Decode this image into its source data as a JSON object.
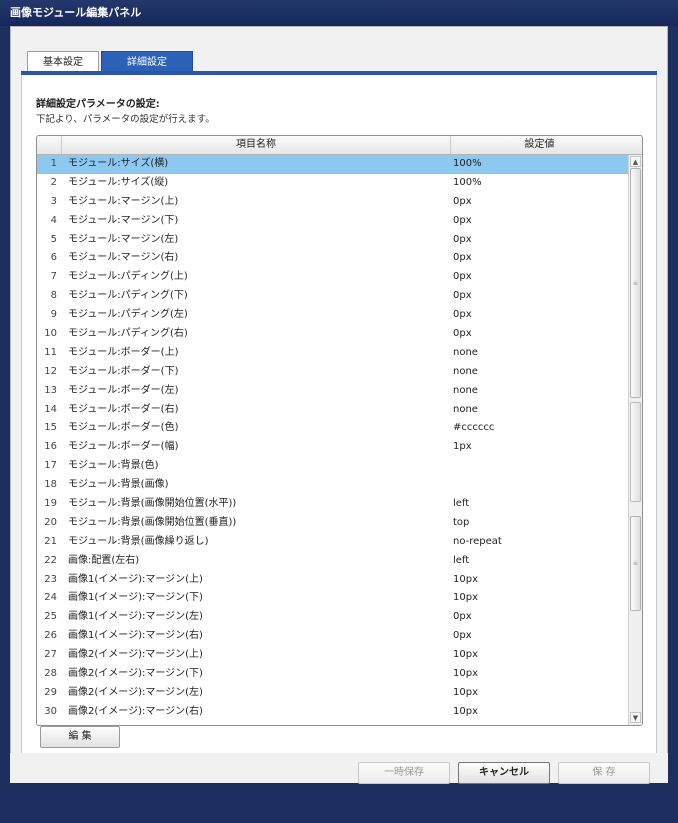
{
  "window": {
    "title": "画像モジュール編集パネル"
  },
  "tabs": {
    "basic": "基本設定",
    "detail": "詳細設定"
  },
  "section": {
    "heading": "詳細設定パラメータの設定:",
    "description": "下記より、パラメータの設定が行えます。"
  },
  "table": {
    "columns": {
      "name": "項目名称",
      "value": "設定値"
    },
    "rows": [
      {
        "num": "1",
        "name": "モジュール:サイズ(横)",
        "value": "100%"
      },
      {
        "num": "2",
        "name": "モジュール:サイズ(縦)",
        "value": "100%"
      },
      {
        "num": "3",
        "name": "モジュール:マージン(上)",
        "value": "0px"
      },
      {
        "num": "4",
        "name": "モジュール:マージン(下)",
        "value": "0px"
      },
      {
        "num": "5",
        "name": "モジュール:マージン(左)",
        "value": "0px"
      },
      {
        "num": "6",
        "name": "モジュール:マージン(右)",
        "value": "0px"
      },
      {
        "num": "7",
        "name": "モジュール:パディング(上)",
        "value": "0px"
      },
      {
        "num": "8",
        "name": "モジュール:パディング(下)",
        "value": "0px"
      },
      {
        "num": "9",
        "name": "モジュール:パディング(左)",
        "value": "0px"
      },
      {
        "num": "10",
        "name": "モジュール:パディング(右)",
        "value": "0px"
      },
      {
        "num": "11",
        "name": "モジュール:ボーダー(上)",
        "value": "none"
      },
      {
        "num": "12",
        "name": "モジュール:ボーダー(下)",
        "value": "none"
      },
      {
        "num": "13",
        "name": "モジュール:ボーダー(左)",
        "value": "none"
      },
      {
        "num": "14",
        "name": "モジュール:ボーダー(右)",
        "value": "none"
      },
      {
        "num": "15",
        "name": "モジュール:ボーダー(色)",
        "value": "#cccccc"
      },
      {
        "num": "16",
        "name": "モジュール:ボーダー(幅)",
        "value": "1px"
      },
      {
        "num": "17",
        "name": "モジュール:背景(色)",
        "value": ""
      },
      {
        "num": "18",
        "name": "モジュール:背景(画像)",
        "value": ""
      },
      {
        "num": "19",
        "name": "モジュール:背景(画像開始位置(水平))",
        "value": "left"
      },
      {
        "num": "20",
        "name": "モジュール:背景(画像開始位置(垂直))",
        "value": "top"
      },
      {
        "num": "21",
        "name": "モジュール:背景(画像繰り返し)",
        "value": "no-repeat"
      },
      {
        "num": "22",
        "name": "画像:配置(左右)",
        "value": "left"
      },
      {
        "num": "23",
        "name": "画像1(イメージ):マージン(上)",
        "value": "10px"
      },
      {
        "num": "24",
        "name": "画像1(イメージ):マージン(下)",
        "value": "10px"
      },
      {
        "num": "25",
        "name": "画像1(イメージ):マージン(左)",
        "value": "0px"
      },
      {
        "num": "26",
        "name": "画像1(イメージ):マージン(右)",
        "value": "0px"
      },
      {
        "num": "27",
        "name": "画像2(イメージ):マージン(上)",
        "value": "10px"
      },
      {
        "num": "28",
        "name": "画像2(イメージ):マージン(下)",
        "value": "10px"
      },
      {
        "num": "29",
        "name": "画像2(イメージ):マージン(左)",
        "value": "10px"
      },
      {
        "num": "30",
        "name": "画像2(イメージ):マージン(右)",
        "value": "10px"
      }
    ],
    "selected_row": 1
  },
  "buttons": {
    "edit": "編 集",
    "temp_save": "一時保存",
    "cancel": "キャンセル",
    "save": "保 存"
  },
  "colors": {
    "title_bar": "#1c2f5e",
    "active_tab": "#2b62b7",
    "selected_row": "#8cc8f0"
  },
  "icons": {
    "scroll_up": "triangle-up-icon",
    "scroll_down": "triangle-down-icon",
    "scroll_grip": "grip-icon"
  }
}
